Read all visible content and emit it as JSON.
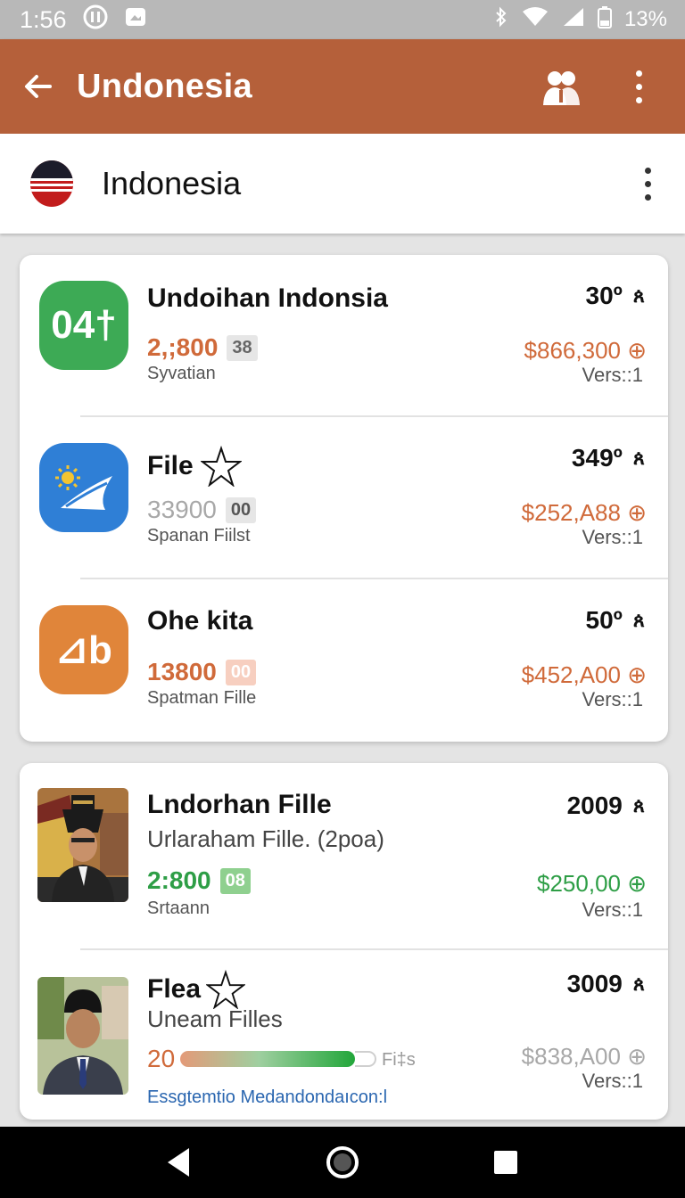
{
  "status_bar": {
    "time": "1:56",
    "battery": "13%",
    "icons": [
      "record-icon",
      "image-icon",
      "bluetooth-icon",
      "wifi-icon",
      "signal-icon",
      "battery-icon"
    ]
  },
  "app_bar": {
    "title": "Undonesia",
    "back_icon": "arrow-left-icon",
    "action_icon": "people-icon",
    "more_icon": "more-vertical-icon",
    "color": "#b5603a"
  },
  "country_header": {
    "name": "Indonesia",
    "flag_icon": "flag-icon"
  },
  "card1": {
    "rows": [
      {
        "title": "Undoihan Indonsia",
        "icon_text": "04†",
        "icon_color": "#3daa55",
        "value": "2,;800",
        "value_color": "orange",
        "chip": "38",
        "label": "Syvatian",
        "temp": "30º",
        "price": "$866,300 ⊕",
        "version": "Vers::1"
      },
      {
        "title": "File",
        "icon_text": "",
        "icon_color": "#2f7fd6",
        "value": "33900",
        "value_color": "grey",
        "chip": "00",
        "label": "Spanan Fiilst",
        "temp": "349º",
        "price": "$252,A88 ⊕",
        "version": "Vers::1"
      },
      {
        "title": "Ohe kita",
        "icon_text": "⊿b",
        "icon_color": "#e0853a",
        "value": "13800",
        "value_color": "orange",
        "chip": "00",
        "label": "Spatman Fille",
        "temp": "50º",
        "price": "$452,A00 ⊕",
        "version": "Vers::1"
      }
    ]
  },
  "card2": {
    "rows": [
      {
        "title": "Lndorhan Fille",
        "subtitle": "Urlaraham Fille. (2poa)",
        "value": "2:800",
        "chip": "08",
        "label": "Srtaann",
        "temp": "2009",
        "price": "$250,00 ⊕",
        "version": "Vers::1"
      },
      {
        "title": "Flea",
        "subtitle": "Uneam Filles",
        "value": "20",
        "progress_label": "Fi‡s",
        "price": "$838,A00 ⊕",
        "temp": "3009",
        "version": "Vers::1",
        "note": "Essgtemtio Medandondaıcon:l"
      }
    ]
  },
  "nav_bar": {
    "back": "back-triangle-icon",
    "home": "home-circle-icon",
    "recents": "recents-square-icon"
  }
}
